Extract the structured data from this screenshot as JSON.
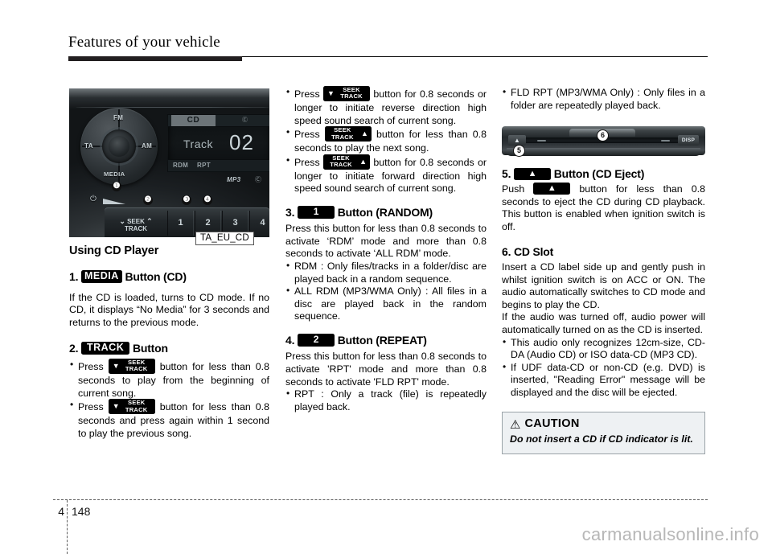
{
  "header": {
    "title": "Features of your vehicle"
  },
  "figure_radio": {
    "caption": "TA_EU_CD",
    "dial": {
      "fm": "FM",
      "ta": "TA",
      "am": "AM",
      "media": "MEDIA",
      "power_icon": "⏻"
    },
    "screen": {
      "source": "CD",
      "disc_icon": "Ⓒ",
      "track_label": "Track",
      "track_number": "02",
      "flag_rdm": "RDM",
      "flag_rpt": "RPT"
    },
    "mp3_logo": "MP3",
    "mp3_dot": "Ⓒ",
    "seek_pad": {
      "down_chevron": "⌄",
      "line1": "SEEK",
      "line2": "TRACK",
      "up_chevron": "⌃"
    },
    "preset_buttons": [
      "1",
      "2",
      "3",
      "4"
    ],
    "callouts": {
      "one": "❶",
      "two": "❷",
      "three": "❸",
      "four": "❹"
    }
  },
  "figure_slot": {
    "eject_glyph": "▲",
    "disp_label": "DISP",
    "callout_5": "5",
    "callout_6": "6"
  },
  "left_column": {
    "section_heading": "Using CD Player",
    "item1": {
      "number": "1.",
      "keycap": "MEDIA",
      "heading_tail": "Button (CD)",
      "body": "If the CD is loaded, turns to CD mode. If no CD, it displays “No Media” for 3 seconds and returns to the previous mode."
    },
    "item2": {
      "number": "2.",
      "keycap": "TRACK",
      "heading_tail": "Button",
      "bullets": [
        {
          "pre": "Press",
          "key": {
            "arrow": "▼",
            "line1": "SEEK",
            "line2": "TRACK",
            "dir": "down"
          },
          "post": "button for less than 0.8 seconds to play from the beginning of current song."
        },
        {
          "pre": "Press",
          "key": {
            "arrow": "▼",
            "line1": "SEEK",
            "line2": "TRACK",
            "dir": "down"
          },
          "post": "button for less than 0.8 seconds and press again within 1 second to play the previous song."
        }
      ]
    }
  },
  "middle_column": {
    "bullets_top": [
      {
        "pre": "Press",
        "key": {
          "arrow": "▼",
          "line1": "SEEK",
          "line2": "TRACK",
          "dir": "down"
        },
        "post": "button for 0.8 seconds or longer to initiate reverse direction high speed sound search of current song."
      },
      {
        "pre": "Press",
        "key": {
          "arrow": "▲",
          "line1": "SEEK",
          "line2": "TRACK",
          "dir": "up"
        },
        "post": "button for less than 0.8 seconds to play the next song."
      },
      {
        "pre": "Press",
        "key": {
          "arrow": "▲",
          "line1": "SEEK",
          "line2": "TRACK",
          "dir": "up"
        },
        "post": "button for 0.8 seconds or longer to initiate forward direction high speed sound search of current song."
      }
    ],
    "item3": {
      "number": "3.",
      "keycap": "1",
      "heading_tail": "Button (RANDOM)",
      "body": "Press this button for less than 0.8 seconds to activate ‘RDM’ mode and more than 0.8 seconds to activate ‘ALL RDM’ mode.",
      "bullets": [
        "RDM : Only files/tracks in a folder/disc are played back in a random sequence.",
        "ALL RDM (MP3/WMA Only) : All files in a disc are played back in the random sequence."
      ]
    },
    "item4": {
      "number": "4.",
      "keycap": "2",
      "heading_tail": "Button (REPEAT)",
      "body": "Press this button for less than 0.8 seconds to activate 'RPT' mode and more than 0.8 seconds to activate 'FLD RPT' mode.",
      "bullets": [
        "RPT : Only a track (file) is repeatedly played back."
      ]
    }
  },
  "right_column": {
    "bullet_top": "FLD RPT (MP3/WMA Only) : Only files in a folder are repeatedly played back.",
    "item5": {
      "number": "5.",
      "keycap_glyph": "▲",
      "heading_tail": "Button (CD Eject)",
      "body_pre": "Push",
      "body_post": "button for less than 0.8 seconds to eject the CD during CD playback. This button is enabled when ignition switch is off."
    },
    "item6": {
      "heading": "6. CD Slot",
      "paragraph1": "Insert a CD label side up and gently push in whilst ignition switch is on ACC or ON. The audio automatically switches to CD mode and begins to play the CD.",
      "paragraph2": "If the audio was turned off, audio power will automatically turned on as the CD is inserted.",
      "bullets": [
        "This audio only recognizes 12cm-size, CD-DA (Audio CD) or ISO data-CD (MP3 CD).",
        "If UDF data-CD or non-CD (e.g. DVD) is inserted, \"Reading Error\" message will be displayed and the disc will be ejected."
      ]
    },
    "caution": {
      "icon": "⚠",
      "title": "CAUTION",
      "text": "Do not insert a CD if CD indicator is lit."
    }
  },
  "footer": {
    "chapter": "4",
    "page": "148",
    "watermark": "carmanualsonline.info"
  }
}
